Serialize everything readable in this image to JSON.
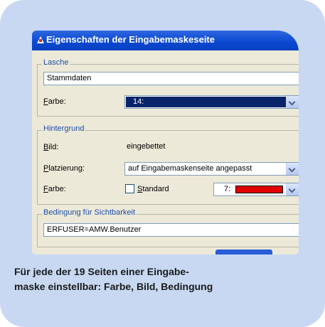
{
  "window": {
    "title": "Eigenschaften der Eingabemaskeseite"
  },
  "lasche": {
    "legend": "Lasche",
    "name_value": "Stammdaten",
    "farbe_label": "Farbe:",
    "farbe_value": "14:",
    "farbe_color": "#0a246a"
  },
  "hintergrund": {
    "legend": "Hintergrund",
    "bild_label": "Bild:",
    "bild_value": "eingebettet",
    "platzierung_label": "Platzierung:",
    "platzierung_value": "auf Eingabemaskenseite angepasst",
    "farbe_label": "Farbe:",
    "standard_label": "Standard",
    "standard_checked": false,
    "farbe_value": "7:",
    "farbe_color": "#e00000"
  },
  "bedingung": {
    "legend": "Bedingung für Sichtbarkeit",
    "value": "ERFUSER=AMW.Benutzer"
  },
  "caption": {
    "line1": "Für jede der 19 Seiten einer Eingabe-",
    "line2": "maske einstellbar: Farbe, Bild, Bedingung"
  }
}
